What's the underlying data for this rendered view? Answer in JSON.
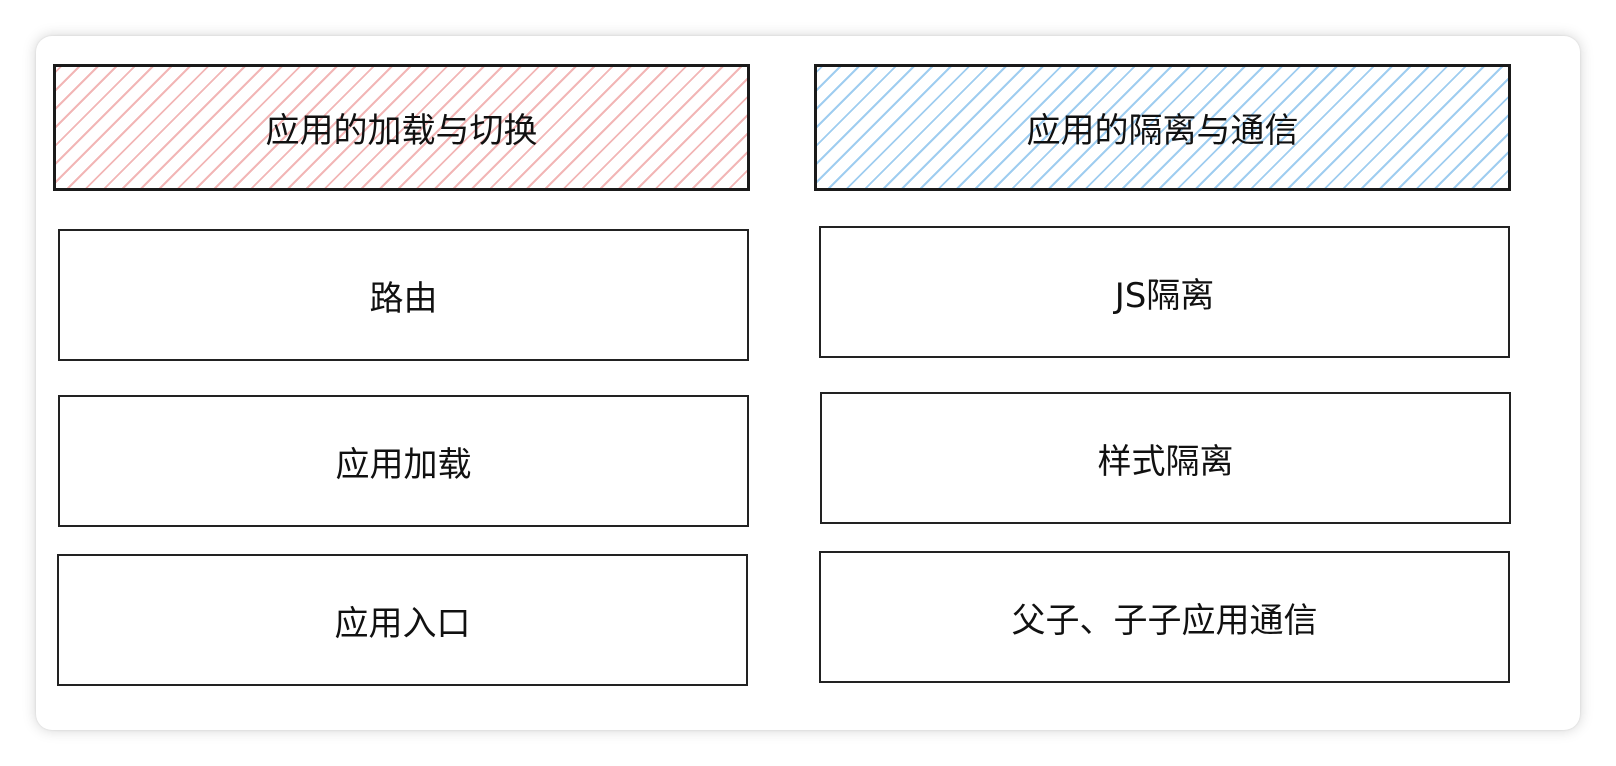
{
  "diagram": {
    "left_column": {
      "header": "应用的加载与切换",
      "items": [
        "路由",
        "应用加载",
        "应用入口"
      ]
    },
    "right_column": {
      "header": "应用的隔离与通信",
      "items": [
        "JS隔离",
        "样式隔离",
        "父子、子子应用通信"
      ]
    },
    "colors": {
      "left_header_hatch": "#f2b6b6",
      "right_header_hatch": "#9fcdf0",
      "border": "#222222"
    }
  }
}
